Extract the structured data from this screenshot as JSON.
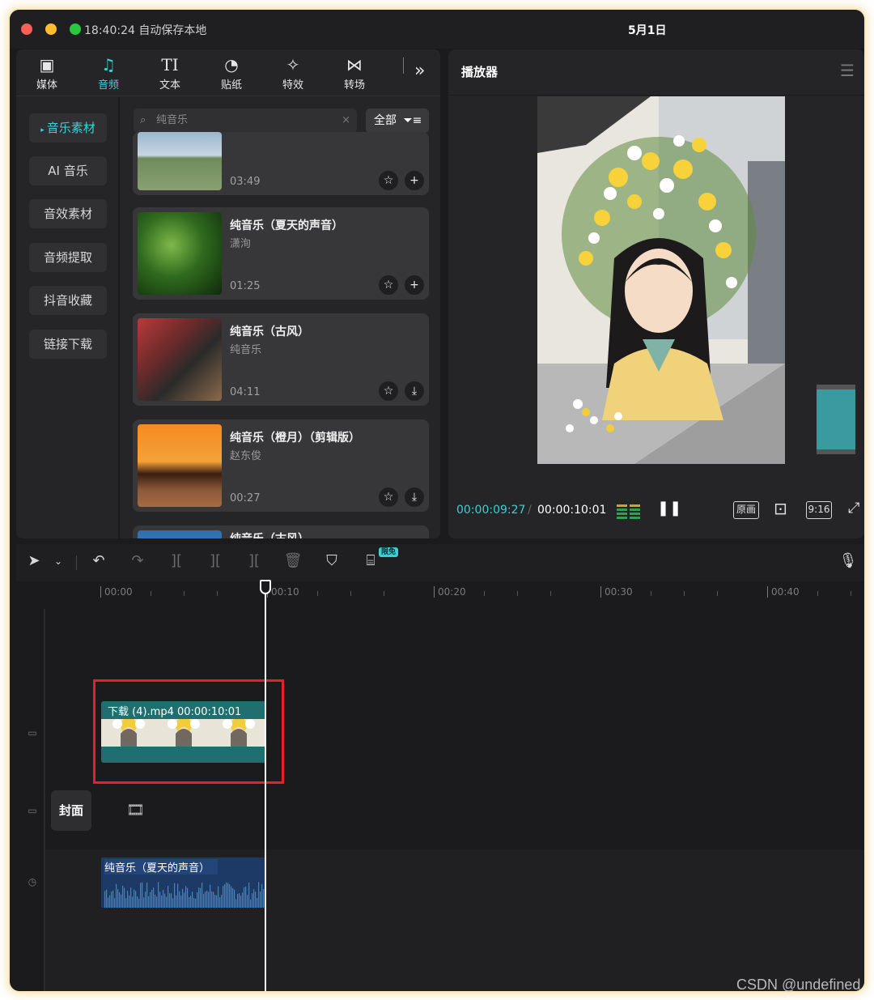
{
  "titlebar": {
    "save_status": "18:40:24 自动保存本地",
    "date": "5月1日"
  },
  "tabs": [
    {
      "label": "媒体",
      "icon": "media-icon"
    },
    {
      "label": "音频",
      "icon": "audio-icon"
    },
    {
      "label": "文本",
      "icon": "text-icon"
    },
    {
      "label": "贴纸",
      "icon": "sticker-icon"
    },
    {
      "label": "特效",
      "icon": "effects-icon"
    },
    {
      "label": "转场",
      "icon": "transition-icon"
    }
  ],
  "categories": [
    "音乐素材",
    "AI 音乐",
    "音效素材",
    "音频提取",
    "抖音收藏",
    "链接下载"
  ],
  "search": {
    "value": "纯音乐",
    "filter_label": "全部"
  },
  "tracks": [
    {
      "title": "",
      "artist": "",
      "duration": "03:49",
      "action": "add"
    },
    {
      "title": "纯音乐（夏天的声音）",
      "artist": "潇洵",
      "duration": "01:25",
      "action": "add"
    },
    {
      "title": "纯音乐（古风）",
      "artist": "纯音乐",
      "duration": "04:11",
      "action": "download"
    },
    {
      "title": "纯音乐（橙月）（剪辑版）",
      "artist": "赵东俊",
      "duration": "00:27",
      "action": "download"
    },
    {
      "title": "纯音乐（古风）",
      "artist": "",
      "duration": "",
      "action": ""
    }
  ],
  "player": {
    "title": "播放器",
    "current_time": "00:00:09:27",
    "separator": "/",
    "total_time": "00:00:10:01",
    "original_label": "原画",
    "ratio_label": "9:16"
  },
  "toolbar": {
    "free_badge": "限免"
  },
  "ruler": [
    "00:00",
    "00:10",
    "00:20",
    "00:30",
    "00:40"
  ],
  "timeline": {
    "video_clip": "下载 (4).mp4   00:00:10:01",
    "cover_label": "封面",
    "audio_clip": "纯音乐（夏天的声音）"
  },
  "watermark": "CSDN @undefined",
  "colors": {
    "accent": "#3ad0d8",
    "highlight": "#e5202a",
    "video_clip": "#1f6f70",
    "audio_clip": "#1d3a66"
  }
}
